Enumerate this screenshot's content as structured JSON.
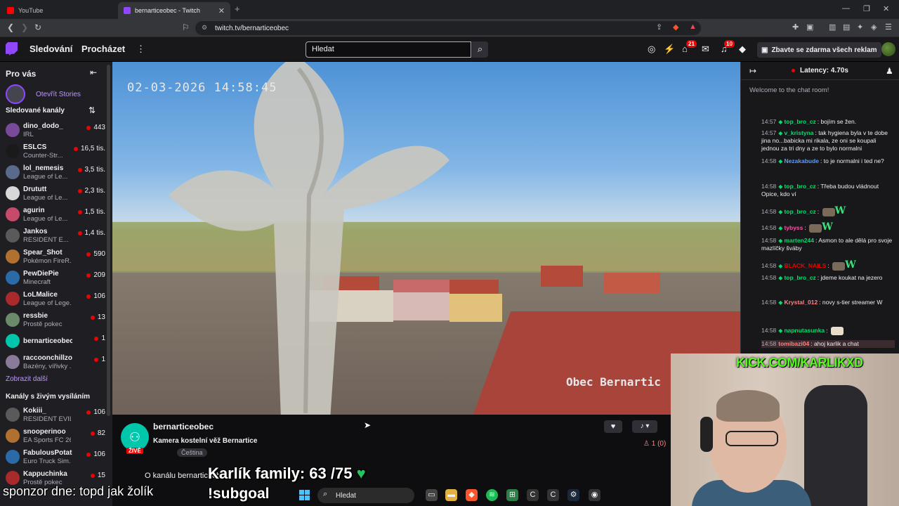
{
  "browser": {
    "tabs": [
      {
        "label": "YouTube",
        "active": false,
        "icon": "youtube-icon"
      },
      {
        "label": "bernarticeobec - Twitch",
        "active": true,
        "icon": "twitch-icon"
      }
    ],
    "url": "twitch.tv/bernarticeobec"
  },
  "topnav": {
    "following": "Sledování",
    "browse": "Procházet",
    "search_placeholder": "Hledat",
    "badge_inbox": "21",
    "badge_notifications": "10",
    "prime_label": "Zbavte se zdarma všech reklam"
  },
  "sidebar": {
    "heading": "Pro vás",
    "stories": "Otevřít Stories",
    "followed_heading": "Sledované kanály",
    "followed": [
      {
        "name": "dino_dodo_",
        "game": "IRL",
        "viewers": "443"
      },
      {
        "name": "ESLCS",
        "game": "Counter-Str...",
        "viewers": "16,5 tis."
      },
      {
        "name": "lol_nemesis",
        "game": "League of Le...",
        "viewers": "3,5 tis."
      },
      {
        "name": "Drututt",
        "game": "League of Le...",
        "viewers": "2,3 tis."
      },
      {
        "name": "agurin",
        "game": "League of Le...",
        "viewers": "1,5 tis."
      },
      {
        "name": "Jankos",
        "game": "RESIDENT E...",
        "viewers": "1,4 tis."
      },
      {
        "name": "Spear_Shot",
        "game": "Pokémon FireR...",
        "viewers": "590"
      },
      {
        "name": "PewDiePie",
        "game": "Minecraft",
        "viewers": "209"
      },
      {
        "name": "LoLMalice",
        "game": "League of Lege...",
        "viewers": "106"
      },
      {
        "name": "ressbie",
        "game": "Prostě pokec",
        "viewers": "13"
      },
      {
        "name": "bernarticeobec",
        "game": "",
        "viewers": "1"
      },
      {
        "name": "raccoonchillzone",
        "game": "Bazény, vířivky ...",
        "viewers": "1"
      }
    ],
    "show_more": "Zobrazit další",
    "live_heading": "Kanály s živým vysíláním",
    "live": [
      {
        "name": "Kokiii_",
        "game": "RESIDENT EVIL...",
        "viewers": "106"
      },
      {
        "name": "snooperinoo",
        "game": "EA Sports FC 26",
        "viewers": "82"
      },
      {
        "name": "FabulousPotato...",
        "game": "Euro Truck Sim...",
        "viewers": "106"
      },
      {
        "name": "Kappuchinka",
        "game": "Prostě pokec",
        "viewers": "15"
      }
    ]
  },
  "video": {
    "timestamp": "02-03-2026 14:58:45",
    "watermark": "Obec Bernartic"
  },
  "channel": {
    "name": "bernarticeobec",
    "title": "Kamera kostelní věž Bernartice",
    "tag": "Čeština",
    "live_badge": "ŽIVĚ",
    "viewers": "1 (0)",
    "about": "O kanálu bernarticeobec"
  },
  "chat": {
    "latency": "Latency: 4.70s",
    "welcome": "Welcome to the chat room!",
    "messages": [
      {
        "time": "14:57",
        "user": "top_bro_cz",
        "color": "#00e06b",
        "text": "bojím se žen."
      },
      {
        "time": "14:57",
        "user": "v_kristyna",
        "color": "#00e06b",
        "text": "tak hygiena byla v te dobe jina no...babicka mi rikala, ze oni se koupali jednou za tri dny a ze to bylo normalni"
      },
      {
        "time": "14:58",
        "user": "Nezakabude",
        "color": "#5c9cff",
        "text": "to je normalni i ted ne?"
      },
      {
        "time": "14:58",
        "user": "top_bro_cz",
        "color": "#00e06b",
        "text": "Třeba budou vládnout Opice, kdo ví"
      },
      {
        "time": "14:58",
        "user": "top_bro_cz",
        "color": "#00e06b",
        "text": "W"
      },
      {
        "time": "14:58",
        "user": "tybyss",
        "color": "#ff4da6",
        "text": "W"
      },
      {
        "time": "14:58",
        "user": "marten244",
        "color": "#00e06b",
        "text": "Asmon to ale dělá pro svoje mazlíčky šváby"
      },
      {
        "time": "14:58",
        "user": "BLACK_NAILS",
        "color": "#eb0400",
        "text": "W"
      },
      {
        "time": "14:58",
        "user": "top_bro_cz",
        "color": "#00e06b",
        "text": "jdeme koukat na jezero"
      },
      {
        "time": "14:58",
        "user": "Krystal_012",
        "color": "#ff8280",
        "text": "novy s-tier streamer W"
      },
      {
        "time": "14:58",
        "user": "napnutasunka",
        "color": "#00e06b",
        "text": ""
      },
      {
        "time": "14:58",
        "user": "tomibazi04",
        "color": "#ff8280",
        "text": "ahoj karlik a chat"
      }
    ]
  },
  "overlay": {
    "kick": "KICK.COM/KARLIKXD",
    "family": "Karlík family: 63 /75",
    "subgoal": "!subgoal",
    "sponsor": "sponzor dne: topd jak žolík"
  },
  "taskbar": {
    "search": "Hledat"
  }
}
